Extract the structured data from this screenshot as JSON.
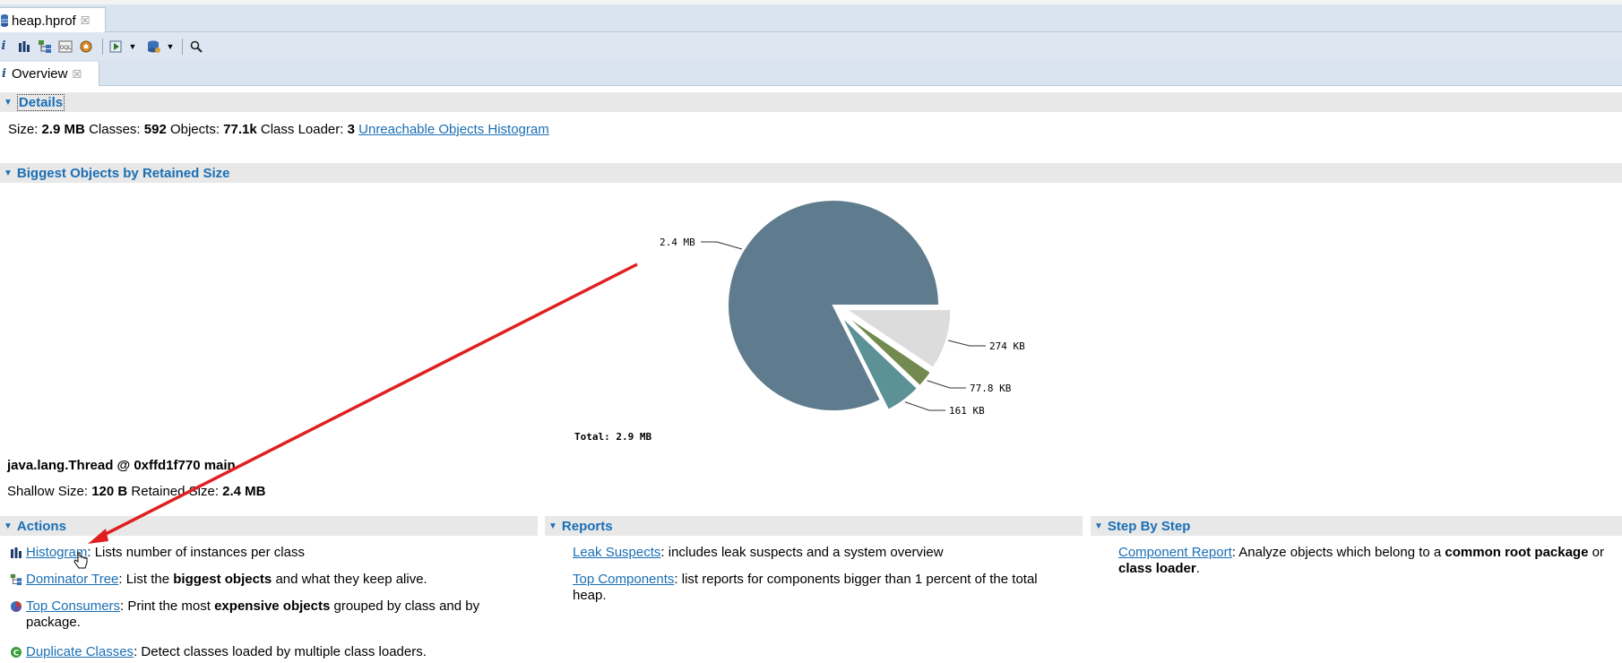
{
  "editor_tab": {
    "title": "heap.hprof"
  },
  "view_tab": {
    "title": "Overview"
  },
  "details": {
    "header": "Details",
    "size_label": "Size:",
    "size_value": "2.9 MB",
    "classes_label": "Classes:",
    "classes_value": "592",
    "objects_label": "Objects:",
    "objects_value": "77.1k",
    "loader_label": "Class Loader:",
    "loader_value": "3",
    "unreachable_link": "Unreachable Objects Histogram"
  },
  "biggest": {
    "header": "Biggest Objects by Retained Size",
    "total_label": "Total: 2.9 MB",
    "selected_object": "java.lang.Thread @ 0xffd1f770 main",
    "shallow_label": "Shallow Size:",
    "shallow_value": "120 B",
    "retained_label": "Retained Size:",
    "retained_value": "2.4 MB"
  },
  "chart_data": {
    "type": "pie",
    "slices": [
      {
        "label": "2.4 MB",
        "value": 2.4,
        "unit": "MB",
        "color": "#5f7c8e"
      },
      {
        "label": "274 KB",
        "value": 0.274,
        "unit": "MB",
        "color": "#dcdcdc"
      },
      {
        "label": "77.8 KB",
        "value": 0.0778,
        "unit": "MB",
        "color": "#728a4f"
      },
      {
        "label": "161 KB",
        "value": 0.161,
        "unit": "MB",
        "color": "#5c9195"
      }
    ],
    "total": "Total: 2.9 MB"
  },
  "actions": {
    "header": "Actions",
    "items": [
      {
        "link": "Histogram",
        "text": ": Lists number of instances per class"
      },
      {
        "link": "Dominator Tree",
        "pre": ": List the ",
        "bold": "biggest objects",
        "post": " and what they keep alive."
      },
      {
        "link": "Top Consumers",
        "pre": ": Print the most ",
        "bold": "expensive objects",
        "post": " grouped by class and by package."
      },
      {
        "link": "Duplicate Classes",
        "text": ": Detect classes loaded by multiple class loaders."
      }
    ]
  },
  "reports": {
    "header": "Reports",
    "items": [
      {
        "link": "Leak Suspects",
        "text": ": includes leak suspects and a system overview"
      },
      {
        "link": "Top Components",
        "text": ": list reports for components bigger than 1 percent of the total heap."
      }
    ]
  },
  "steps": {
    "header": "Step By Step",
    "items": [
      {
        "link": "Component Report",
        "pre": ": Analyze objects which belong to a ",
        "bold": "common root package",
        "post": " or ",
        "bold2": "class loader",
        "post2": "."
      }
    ]
  },
  "colors": {
    "accent": "#1a6fb5",
    "arrow": "#e02020"
  }
}
